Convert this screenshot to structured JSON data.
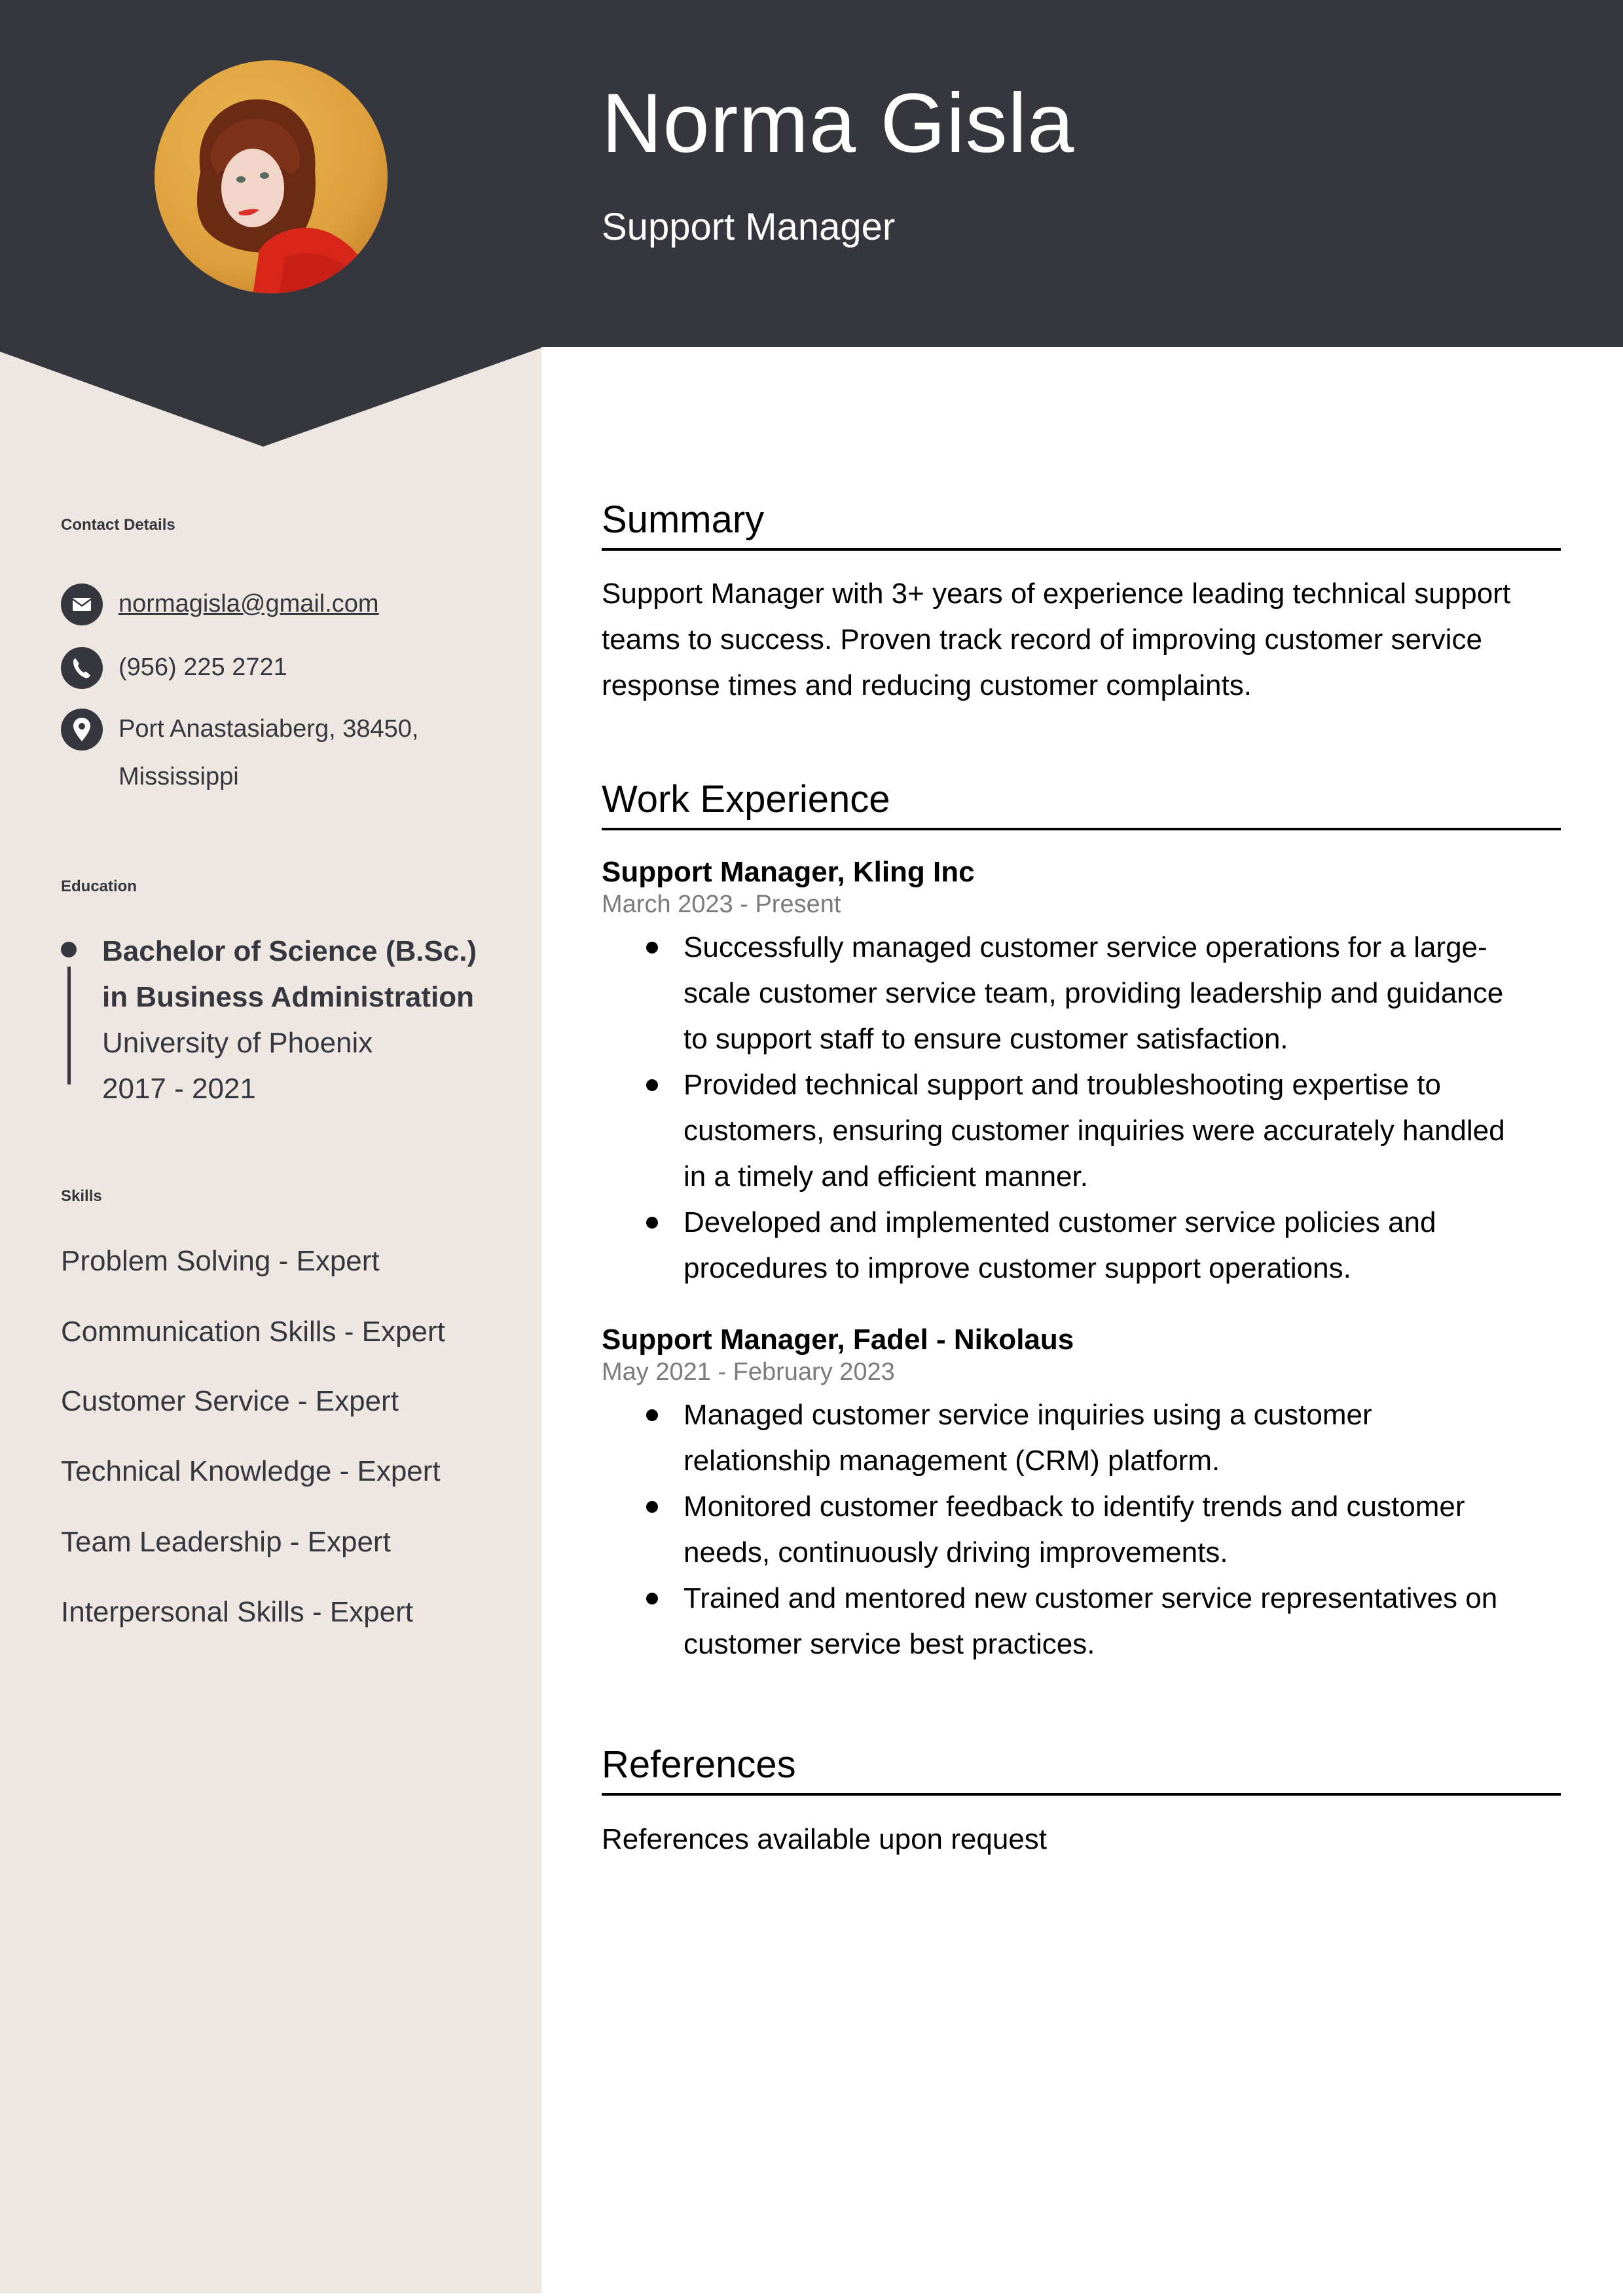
{
  "header": {
    "name": "Norma Gisla",
    "title": "Support Manager",
    "colors": {
      "header_bg": "#36373e",
      "sidebar_bg": "#eee6e1",
      "text_dark": "#36373e"
    }
  },
  "photo": {
    "icon": "profile-photo",
    "description": "Woman with curly auburn hair in red sweater on yellow background"
  },
  "sidebar": {
    "contact": {
      "heading": "Contact Details",
      "email": {
        "icon": "envelope-icon",
        "value": "normagisla@gmail.com"
      },
      "phone": {
        "icon": "phone-icon",
        "value": "(956) 225 2721"
      },
      "address": {
        "icon": "map-pin-icon",
        "line1": "Port Anastasiaberg, 38450,",
        "line2": "Mississippi"
      }
    },
    "education": {
      "heading": "Education",
      "items": [
        {
          "degree_line1": "Bachelor of Science (B.Sc.)",
          "degree_line2": "in Business Administration",
          "school": "University of Phoenix",
          "years": "2017 - 2021"
        }
      ]
    },
    "skills": {
      "heading": "Skills",
      "items": [
        "Problem Solving - Expert",
        "Communication Skills - Expert",
        "Customer Service - Expert",
        "Technical Knowledge - Expert",
        "Team Leadership - Expert",
        "Interpersonal Skills - Expert"
      ]
    }
  },
  "main": {
    "summary": {
      "heading": "Summary",
      "lines": [
        "Support Manager with 3+ years of experience leading technical support",
        "teams to success. Proven track record of improving customer service",
        "response times and reducing customer complaints."
      ]
    },
    "experience": {
      "heading": "Work Experience",
      "jobs": [
        {
          "title": "Support Manager, Kling Inc",
          "dates": "March 2023 - Present",
          "bullets": [
            [
              "Successfully managed customer service operations for a large-",
              "scale customer service team, providing leadership and guidance",
              "to support staff to ensure customer satisfaction."
            ],
            [
              "Provided technical support and troubleshooting expertise to",
              "customers, ensuring customer inquiries were accurately handled",
              "in a timely and efficient manner."
            ],
            [
              "Developed and implemented customer service policies and",
              "procedures to improve customer support operations."
            ]
          ]
        },
        {
          "title": "Support Manager, Fadel - Nikolaus",
          "dates": "May 2021 - February 2023",
          "bullets": [
            [
              "Managed customer service inquiries using a customer",
              "relationship management (CRM) platform."
            ],
            [
              "Monitored customer feedback to identify trends and customer",
              "needs, continuously driving improvements."
            ],
            [
              "Trained and mentored new customer service representatives on",
              "customer service best practices."
            ]
          ]
        }
      ]
    },
    "references": {
      "heading": "References",
      "text": "References available upon request"
    }
  }
}
